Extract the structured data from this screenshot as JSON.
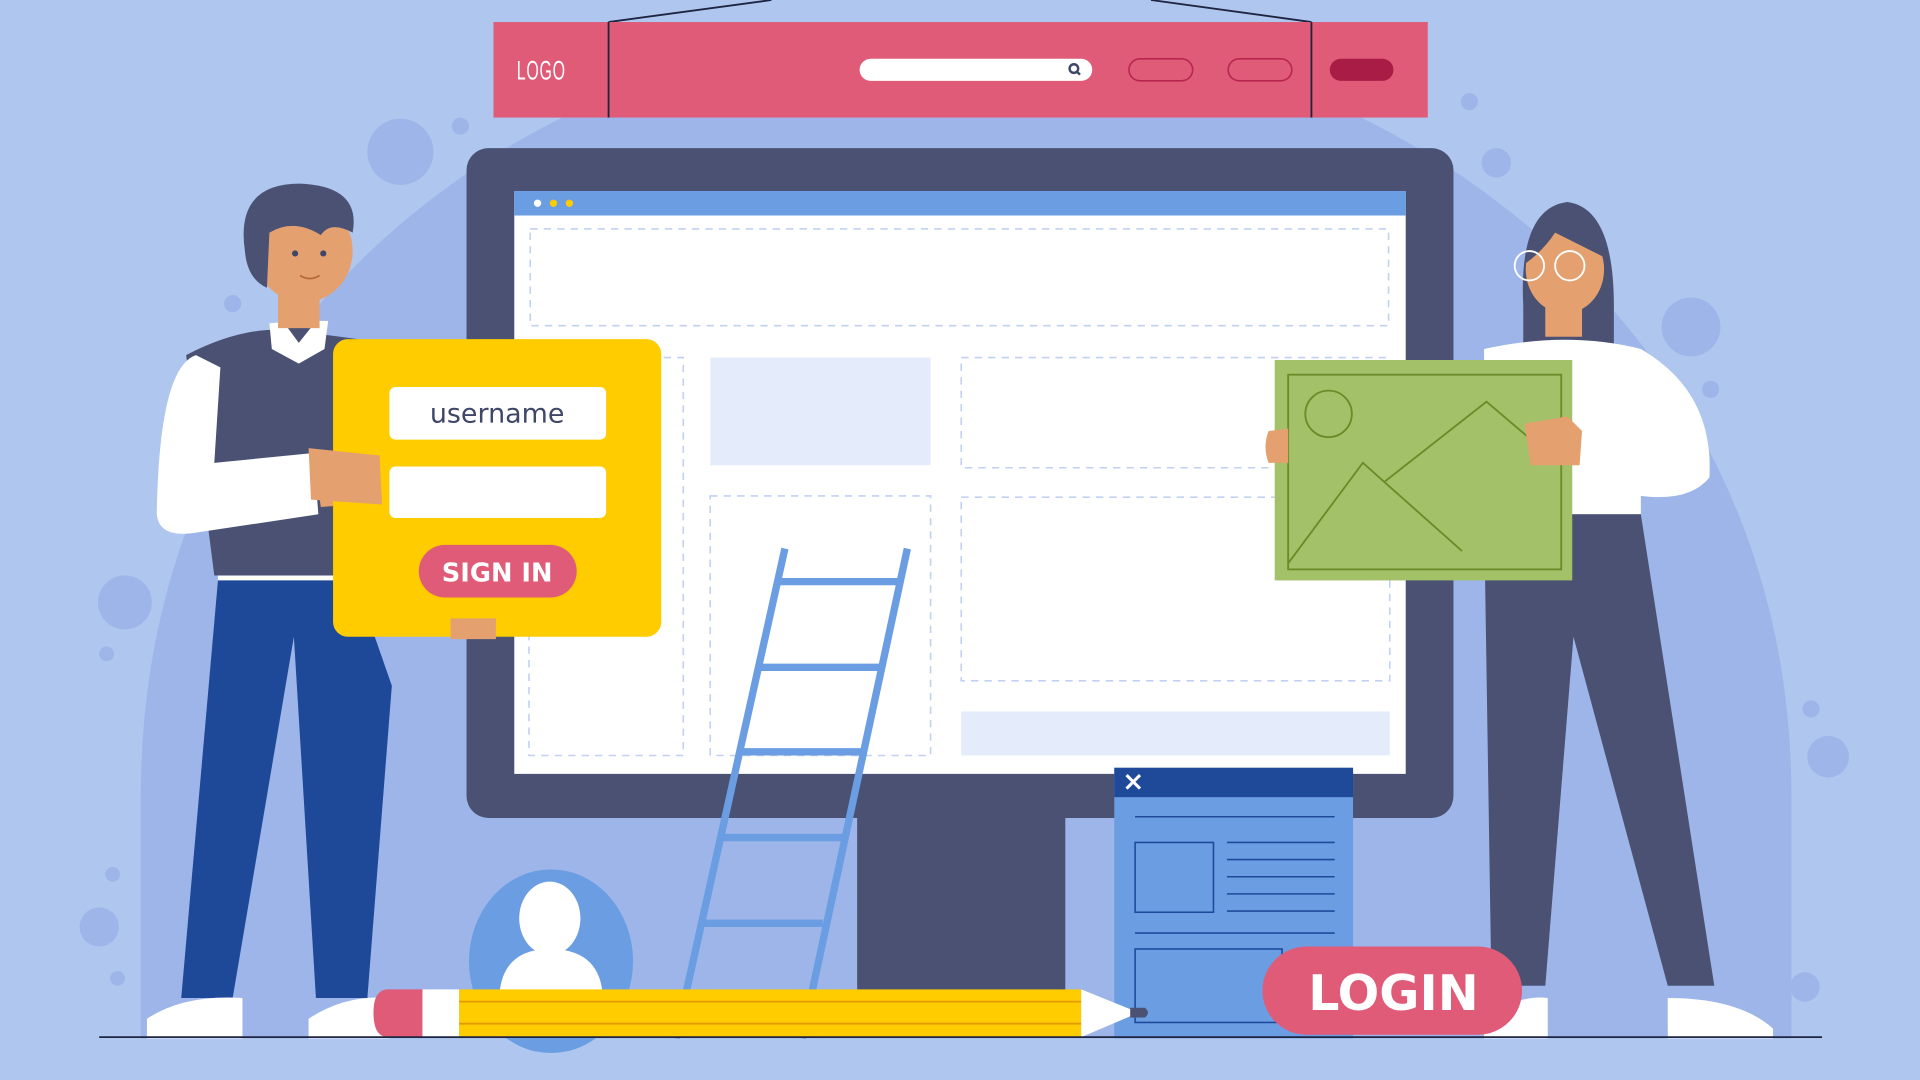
{
  "scene": {
    "title": "Login / sign-in web page illustration",
    "colors": {
      "background": "#afc6ef",
      "backdrop_blob": "#9db5e8",
      "nav_bar": "#e05b78",
      "nav_accent": "#a81c45",
      "monitor": "#4a5173",
      "browser_header": "#6b9de3",
      "login_card": "#ffcc00",
      "button_pink": "#e05b78",
      "picture_card": "#a3c168",
      "popup_header": "#1f4a9a",
      "popup_body": "#6b9de3"
    }
  },
  "nav_bar": {
    "logo": "LOGO",
    "search_icon": "search-icon",
    "search_value": ""
  },
  "browser": {
    "window_dots": [
      "close-dot",
      "minimize-dot",
      "maximize-dot"
    ]
  },
  "login_card": {
    "username_placeholder": "username",
    "password_value": "",
    "sign_in_label": "SIGN IN"
  },
  "popup_window": {
    "close_icon": "close-icon"
  },
  "login_button": {
    "label": "LOGIN"
  },
  "picture_card": {
    "icon": "image-icon"
  },
  "avatar": {
    "icon": "user-icon"
  }
}
